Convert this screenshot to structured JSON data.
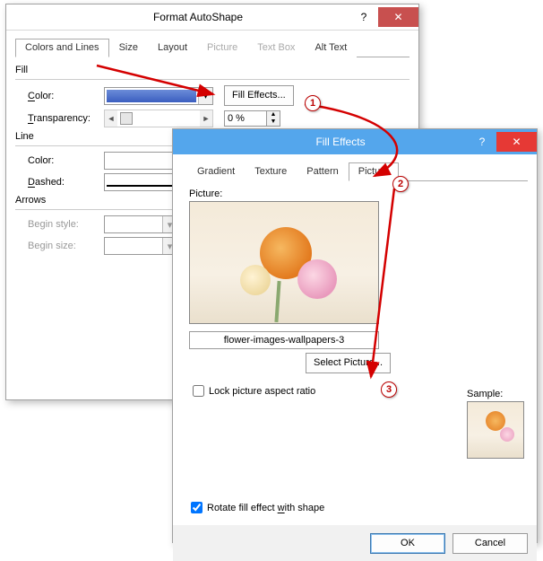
{
  "dlg1": {
    "title": "Format AutoShape",
    "tabs": [
      "Colors and Lines",
      "Size",
      "Layout",
      "Picture",
      "Text Box",
      "Alt Text"
    ],
    "fill": {
      "group": "Fill",
      "color_label": "Color:",
      "swatch": "#4a6fc7",
      "effects_btn": "Fill Effects...",
      "transp_label": "Transparency:",
      "transp_value": "0 %"
    },
    "line": {
      "group": "Line",
      "color_label": "Color:",
      "dashed_label": "Dashed:"
    },
    "arrows": {
      "group": "Arrows",
      "begin_style": "Begin style:",
      "begin_size": "Begin size:"
    }
  },
  "dlg2": {
    "title": "Fill Effects",
    "tabs": [
      "Gradient",
      "Texture",
      "Pattern",
      "Picture"
    ],
    "pic_label": "Picture:",
    "filename": "flower-images-wallpapers-3",
    "select_btn": "Select Picture...",
    "lock_label": "Lock picture aspect ratio",
    "sample_label": "Sample:",
    "rotate_label": "Rotate fill effect with shape",
    "ok": "OK",
    "cancel": "Cancel"
  },
  "badges": {
    "b1": "1",
    "b2": "2",
    "b3": "3"
  }
}
